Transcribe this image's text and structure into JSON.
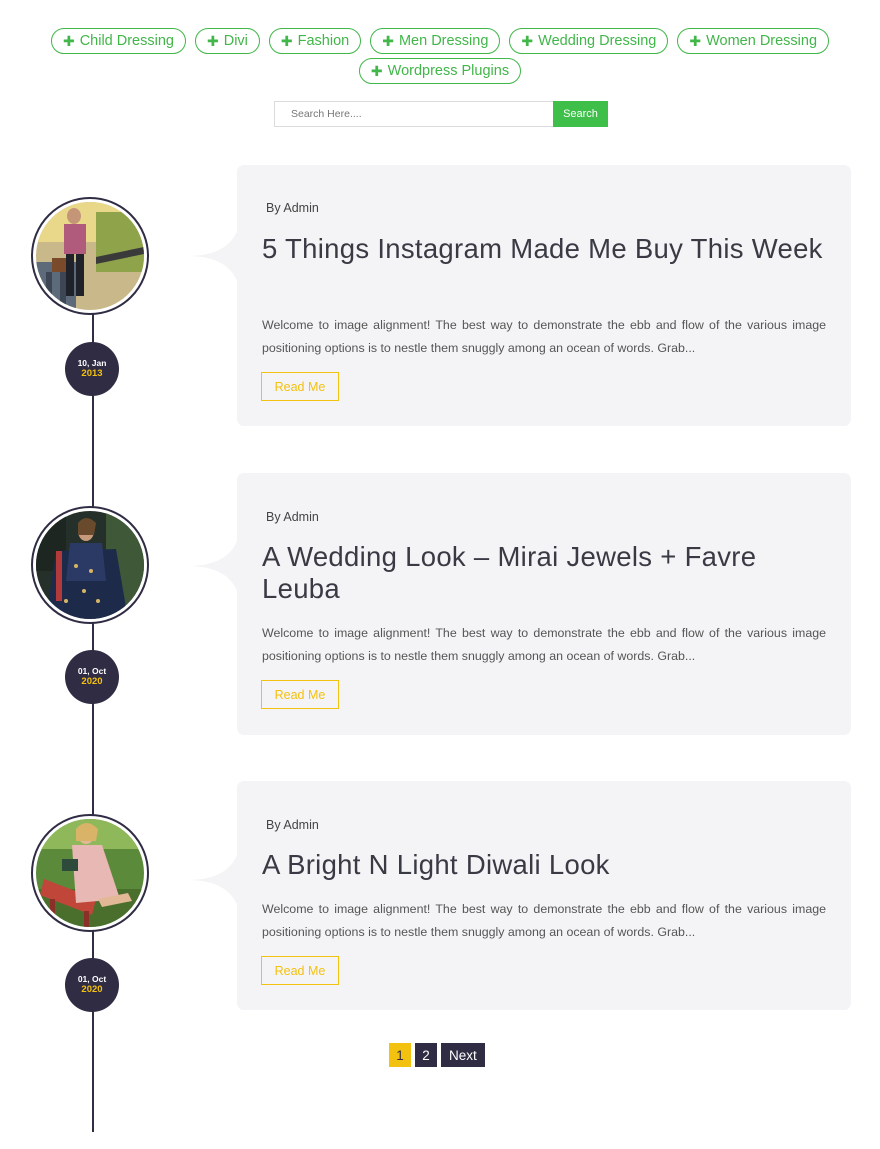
{
  "categories": [
    "Child Dressing",
    "Divi",
    "Fashion",
    "Men Dressing",
    "Wedding Dressing",
    "Women Dressing",
    "Wordpress Plugins"
  ],
  "search": {
    "placeholder": "Search Here....",
    "button_label": "Search"
  },
  "posts": [
    {
      "author": "By Admin",
      "title": "5 Things Instagram Made Me Buy This Week",
      "excerpt": "Welcome to image alignment! The best way to demonstrate the ebb and flow of the various image positioning options is to nestle them snuggly among an ocean of words. Grab...",
      "read_more": "Read Me",
      "date_day_month": "10, Jan",
      "date_year": "2013"
    },
    {
      "author": "By Admin",
      "title": "A Wedding Look – Mirai Jewels + Favre Leuba",
      "excerpt": "Welcome to image alignment! The best way to demonstrate the ebb and flow of the various image positioning options is to nestle them snuggly among an ocean of words. Grab...",
      "read_more": "Read Me",
      "date_day_month": "01, Oct",
      "date_year": "2020"
    },
    {
      "author": "By Admin",
      "title": "A Bright N Light Diwali Look",
      "excerpt": "Welcome to image alignment! The best way to demonstrate the ebb and flow of the various image positioning options is to nestle them snuggly among an ocean of words. Grab...",
      "read_more": "Read Me",
      "date_day_month": "01, Oct",
      "date_year": "2020"
    }
  ],
  "pagination": {
    "pages": [
      "1",
      "2"
    ],
    "current": "1",
    "next_label": "Next"
  },
  "colors": {
    "accent_green": "#41b649",
    "timeline_dark": "#2f2c44",
    "highlight_yellow": "#f3c10f",
    "card_bg": "#f4f4f6"
  }
}
